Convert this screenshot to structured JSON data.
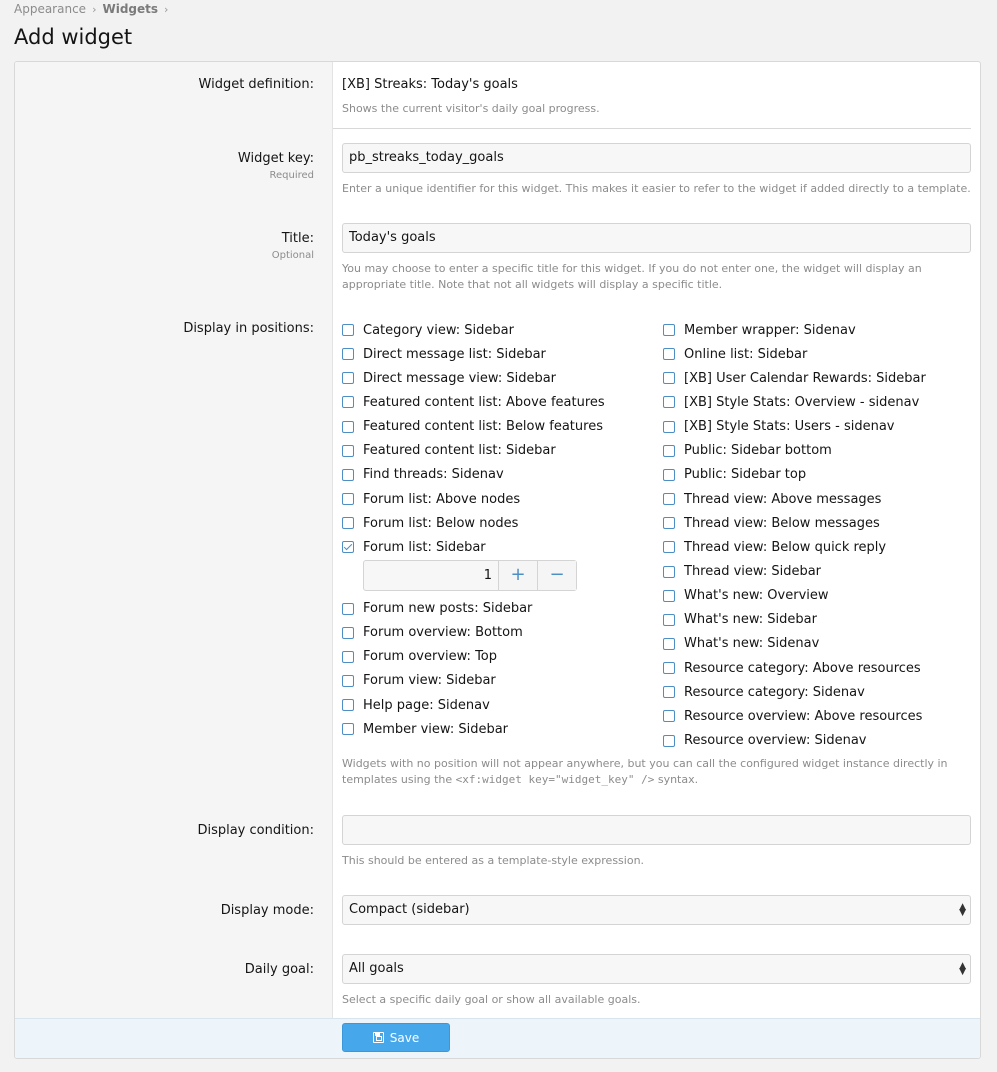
{
  "breadcrumb": {
    "items": [
      "Appearance",
      "Widgets"
    ],
    "sep": "›"
  },
  "page_title": "Add widget",
  "definition": {
    "label": "Widget definition:",
    "value": "[XB] Streaks: Today's goals",
    "explain": "Shows the current visitor's daily goal progress."
  },
  "widget_key": {
    "label": "Widget key:",
    "hint": "Required",
    "value": "pb_streaks_today_goals",
    "explain": "Enter a unique identifier for this widget. This makes it easier to refer to the widget if added directly to a template."
  },
  "title": {
    "label": "Title:",
    "hint": "Optional",
    "value": "Today's goals",
    "explain": "You may choose to enter a specific title for this widget. If you do not enter one, the widget will display an appropriate title. Note that not all widgets will display a specific title."
  },
  "positions": {
    "label": "Display in positions:",
    "left": [
      {
        "label": "Category view: Sidebar",
        "checked": false
      },
      {
        "label": "Direct message list: Sidebar",
        "checked": false
      },
      {
        "label": "Direct message view: Sidebar",
        "checked": false
      },
      {
        "label": "Featured content list: Above features",
        "checked": false
      },
      {
        "label": "Featured content list: Below features",
        "checked": false
      },
      {
        "label": "Featured content list: Sidebar",
        "checked": false
      },
      {
        "label": "Find threads: Sidenav",
        "checked": false
      },
      {
        "label": "Forum list: Above nodes",
        "checked": false
      },
      {
        "label": "Forum list: Below nodes",
        "checked": false
      },
      {
        "label": "Forum list: Sidebar",
        "checked": true
      },
      {
        "label": "Forum new posts: Sidebar",
        "checked": false
      },
      {
        "label": "Forum overview: Bottom",
        "checked": false
      },
      {
        "label": "Forum overview: Top",
        "checked": false
      },
      {
        "label": "Forum view: Sidebar",
        "checked": false
      },
      {
        "label": "Help page: Sidenav",
        "checked": false
      },
      {
        "label": "Member view: Sidebar",
        "checked": false
      }
    ],
    "right": [
      {
        "label": "Member wrapper: Sidenav",
        "checked": false
      },
      {
        "label": "Online list: Sidebar",
        "checked": false
      },
      {
        "label": "[XB] User Calendar Rewards: Sidebar",
        "checked": false
      },
      {
        "label": "[XB] Style Stats: Overview - sidenav",
        "checked": false
      },
      {
        "label": "[XB] Style Stats: Users - sidenav",
        "checked": false
      },
      {
        "label": "Public: Sidebar bottom",
        "checked": false
      },
      {
        "label": "Public: Sidebar top",
        "checked": false
      },
      {
        "label": "Thread view: Above messages",
        "checked": false
      },
      {
        "label": "Thread view: Below messages",
        "checked": false
      },
      {
        "label": "Thread view: Below quick reply",
        "checked": false
      },
      {
        "label": "Thread view: Sidebar",
        "checked": false
      },
      {
        "label": "What's new: Overview",
        "checked": false
      },
      {
        "label": "What's new: Sidebar",
        "checked": false
      },
      {
        "label": "What's new: Sidenav",
        "checked": false
      },
      {
        "label": "Resource category: Above resources",
        "checked": false
      },
      {
        "label": "Resource category: Sidenav",
        "checked": false
      },
      {
        "label": "Resource overview: Above resources",
        "checked": false
      },
      {
        "label": "Resource overview: Sidenav",
        "checked": false
      }
    ],
    "stepper": {
      "value": "1",
      "plus": "+",
      "minus": "−"
    },
    "explain_before": "Widgets with no position will not appear anywhere, but you can call the configured widget instance directly in templates using the ",
    "explain_code": "<xf:widget key=\"widget_key\" />",
    "explain_after": " syntax."
  },
  "condition": {
    "label": "Display condition:",
    "value": "",
    "explain": "This should be entered as a template-style expression."
  },
  "display_mode": {
    "label": "Display mode:",
    "value": "Compact (sidebar)"
  },
  "daily_goal": {
    "label": "Daily goal:",
    "value": "All goals",
    "explain": "Select a specific daily goal or show all available goals."
  },
  "save_label": "Save",
  "colors": {
    "accent": "#47a7eb",
    "checkbox": "#4d8fc4",
    "label_bg": "#f5f5f5",
    "footer_bg": "#edf4fa"
  }
}
